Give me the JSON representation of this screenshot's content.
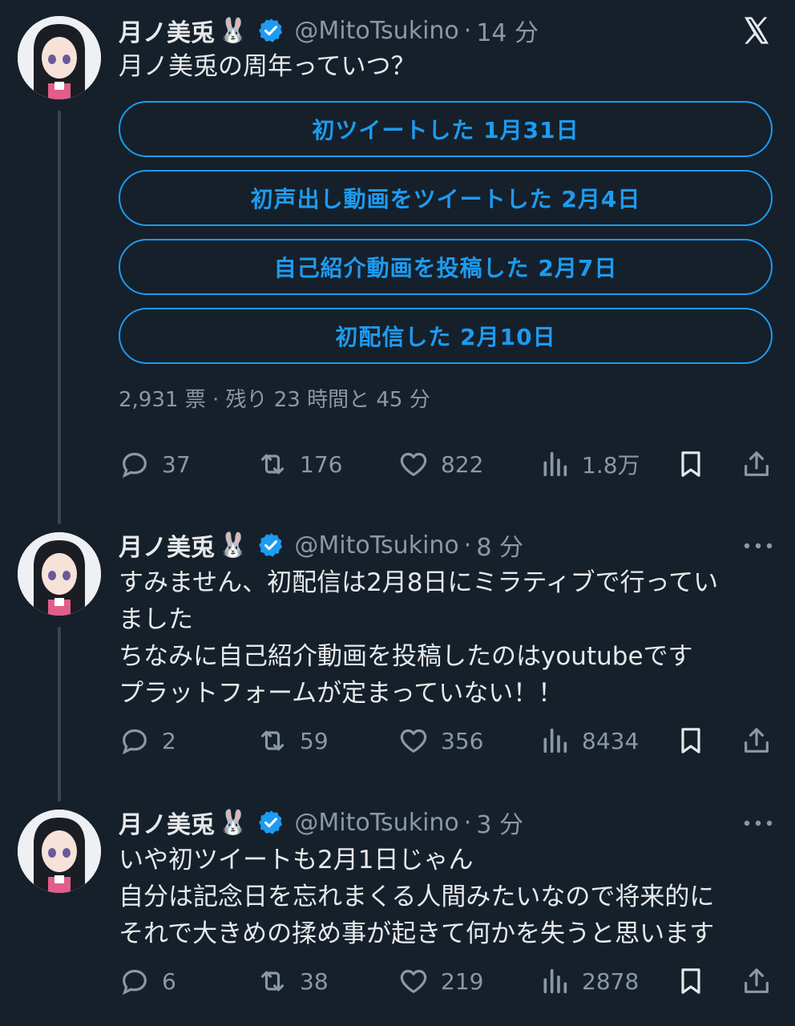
{
  "tweets": [
    {
      "name": "月ノ美兎",
      "name_emoji": "🐰",
      "handle": "@MitoTsukino",
      "separator": "·",
      "time": "14 分",
      "text_lines": [
        "月ノ美兎の周年っていつ？"
      ],
      "poll": {
        "options": [
          "初ツイートした 1月31日",
          "初声出し動画をツイートした 2月4日",
          "自己紹介動画を投稿した 2月7日",
          "初配信した 2月10日"
        ],
        "meta": "2,931 票 · 残り 23 時間と 45 分"
      },
      "stats": {
        "replies": "37",
        "retweets": "176",
        "likes": "822",
        "views": "1.8万"
      }
    },
    {
      "name": "月ノ美兎",
      "name_emoji": "🐰",
      "handle": "@MitoTsukino",
      "separator": "·",
      "time": "8 分",
      "text_lines": [
        "すみません、初配信は2月8日にミラティブで行ってい",
        "ました",
        "ちなみに自己紹介動画を投稿したのはyoutubeです",
        "プラットフォームが定まっていない！！"
      ],
      "stats": {
        "replies": "2",
        "retweets": "59",
        "likes": "356",
        "views": "8434"
      }
    },
    {
      "name": "月ノ美兎",
      "name_emoji": "🐰",
      "handle": "@MitoTsukino",
      "separator": "·",
      "time": "3 分",
      "text_lines": [
        "いや初ツイートも2月1日じゃん",
        "自分は記念日を忘れまくる人間みたいなので将来的に",
        "それで大きめの揉め事が起きて何かを失うと思います"
      ],
      "stats": {
        "replies": "6",
        "retweets": "38",
        "likes": "219",
        "views": "2878"
      }
    }
  ],
  "colors": {
    "background": "#15202b",
    "accent": "#1d9bf0",
    "muted": "#8b98a5",
    "text": "#e7e9ea"
  },
  "icons": [
    "x-logo-icon",
    "verified-badge-icon",
    "reply-icon",
    "retweet-icon",
    "like-icon",
    "views-icon",
    "bookmark-icon",
    "share-icon",
    "more-icon"
  ]
}
